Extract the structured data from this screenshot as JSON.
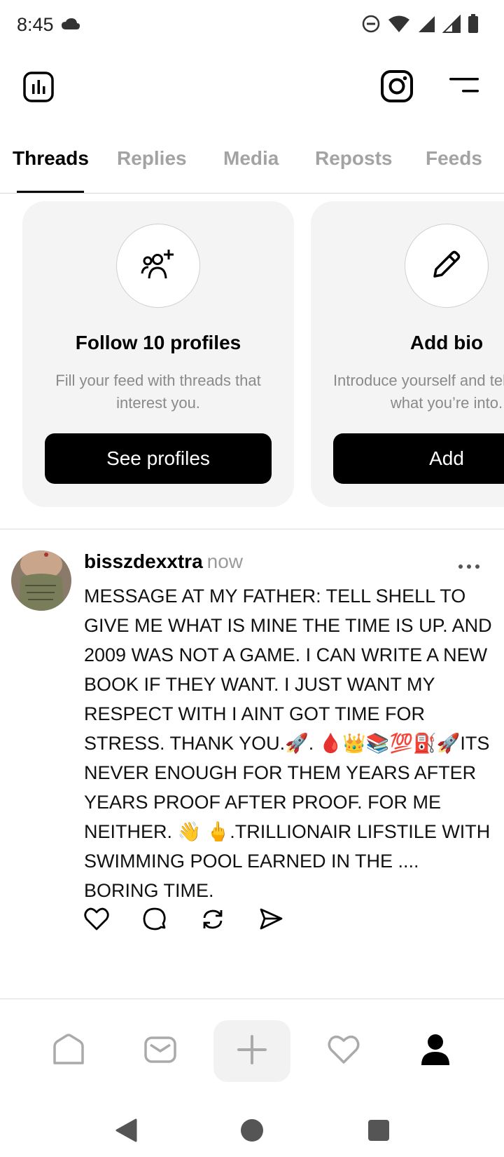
{
  "status_bar": {
    "time": "8:45",
    "icons": [
      "cloud-icon",
      "do-not-disturb-icon",
      "wifi-icon",
      "signal-icon",
      "signal-icon",
      "battery-icon"
    ]
  },
  "top_bar": {
    "icons": [
      "insights-icon",
      "instagram-icon",
      "menu-icon"
    ]
  },
  "tabs": [
    {
      "label": "Threads",
      "active": true
    },
    {
      "label": "Replies",
      "active": false
    },
    {
      "label": "Media",
      "active": false
    },
    {
      "label": "Reposts",
      "active": false
    },
    {
      "label": "Feeds",
      "active": false
    }
  ],
  "cards": [
    {
      "icon": "add-people-icon",
      "title": "Follow 10 profiles",
      "description": "Fill your feed with threads that interest you.",
      "button": "See profiles"
    },
    {
      "icon": "pencil-icon",
      "title": "Add bio",
      "description": "Introduce yourself and tell people what you’re into.",
      "button": "Add"
    }
  ],
  "post": {
    "username": "bisszdexxtra",
    "time": "now",
    "text": "MESSAGE AT MY FATHER: TELL SHELL TO GIVE ME WHAT IS MINE THE TIME IS UP. AND 2009 WAS NOT A GAME. I CAN WRITE A NEW BOOK IF THEY WANT. I JUST WANT MY RESPECT WITH I AINT GOT TIME FOR STRESS. THANK YOU.🚀. 🩸👑📚💯⛽🚀ITS NEVER ENOUGH FOR THEM YEARS AFTER YEARS PROOF AFTER PROOF. FOR ME NEITHER. 👋 🖕.TRILLIONAIR LIFSTILE WITH SWIMMING POOL EARNED IN THE .... BORING TIME.",
    "actions": [
      "like-icon",
      "comment-icon",
      "repost-icon",
      "share-icon"
    ]
  },
  "bottom_nav": [
    "home-icon",
    "inbox-icon",
    "create-icon",
    "activity-icon",
    "profile-icon"
  ],
  "system_nav": [
    "back-icon",
    "home-circle-icon",
    "recents-icon"
  ],
  "colors": {
    "accent": "#000000",
    "muted_text": "#a3a3a3",
    "card_bg": "#f4f4f4"
  }
}
